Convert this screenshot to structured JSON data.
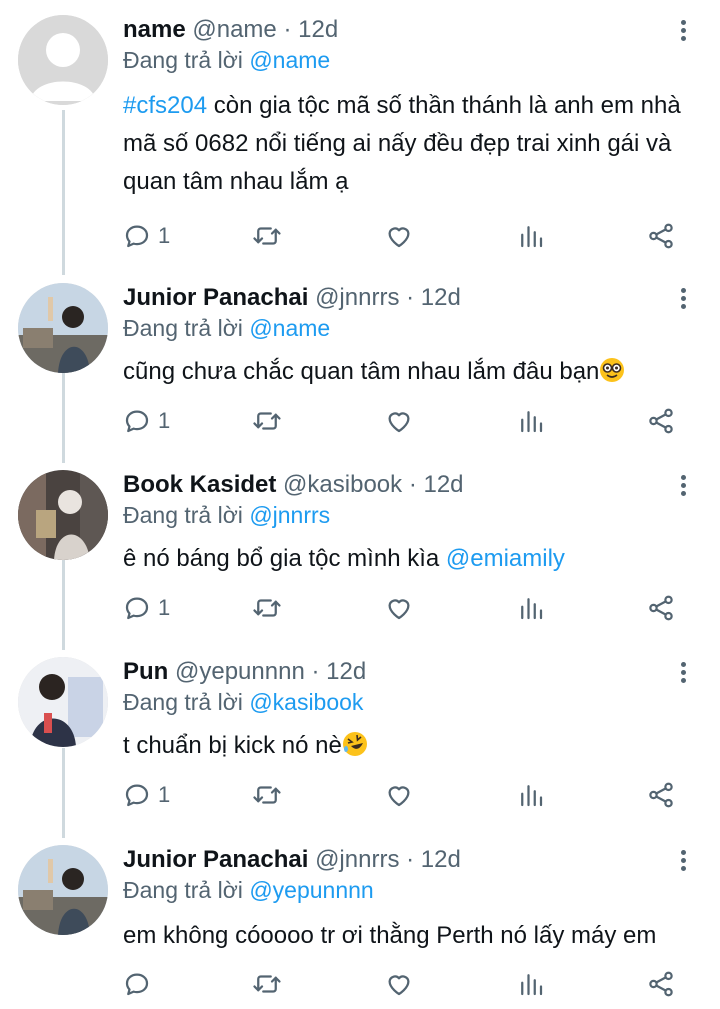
{
  "replying_prefix": "Đang trả lời",
  "tweets": [
    {
      "name": "name",
      "handle": "@name",
      "dot": "·",
      "time": "12d",
      "reply_to": "@name",
      "body_tag": "#cfs204",
      "body": " còn gia tộc mã số thần thánh là anh em nhà mã số 0682 nổi tiếng ai nấy đều đẹp trai xinh gái và quan tâm nhau lắm ạ",
      "reply_count": "1",
      "avatar": "default-avatar"
    },
    {
      "name": "Junior Panachai",
      "handle": "@jnnrrs",
      "dot": "·",
      "time": "12d",
      "reply_to": "@name",
      "body": "cũng chưa chắc quan tâm nhau lắm đâu bạn",
      "emoji": "nerd-face-emoji",
      "reply_count": "1",
      "avatar": "photo-avatar-junior"
    },
    {
      "name": "Book Kasidet",
      "handle": "@kasibook",
      "dot": "·",
      "time": "12d",
      "reply_to": "@jnnrrs",
      "body": "ê nó báng bổ gia tộc mình kìa ",
      "body_mention": "@emiamily",
      "reply_count": "1",
      "avatar": "photo-avatar-book"
    },
    {
      "name": "Pun",
      "handle": "@yepunnnn",
      "dot": "·",
      "time": "12d",
      "reply_to": "@kasibook",
      "body": "t chuẩn bị kick nó nè",
      "emoji": "rolling-laughing-emoji",
      "reply_count": "1",
      "avatar": "photo-avatar-pun"
    },
    {
      "name": "Junior Panachai",
      "handle": "@jnnrrs",
      "dot": "·",
      "time": "12d",
      "reply_to": "@yepunnnn",
      "body": "em không cóoooo tr ơi thằng Perth nó lấy máy em",
      "reply_count": "",
      "avatar": "photo-avatar-junior"
    }
  ],
  "colors": {
    "text": "#0f1419",
    "secondary": "#536471",
    "link": "#1d9bf0",
    "thread_line": "#cfd9de"
  },
  "icons": [
    "reply-icon",
    "retweet-icon",
    "like-icon",
    "views-icon",
    "share-icon",
    "more-icon"
  ]
}
